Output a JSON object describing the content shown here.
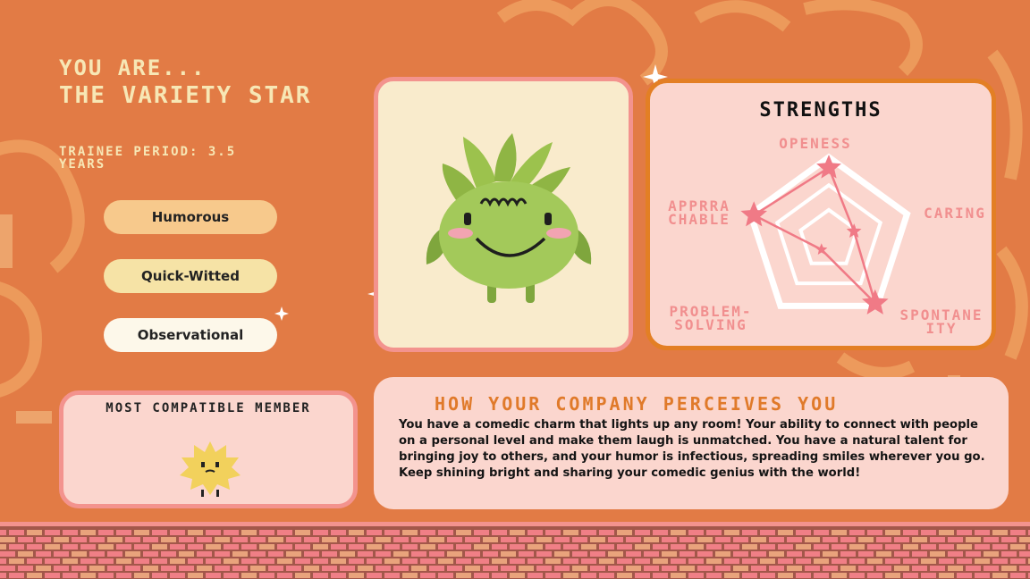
{
  "header": {
    "you_are": "YOU ARE...",
    "result_title": "THE VARIETY STAR",
    "trainee_period": "TRAINEE PERIOD: 3.5 YEARS"
  },
  "traits": [
    "Humorous",
    "Quick-Witted",
    "Observational"
  ],
  "strengths": {
    "title": "STRENGTHS",
    "axes": [
      "OPENESS",
      "CARING",
      "APPRRA CHABLE",
      "PROBLEM- SOLVING",
      "SPONTANE ITY"
    ]
  },
  "chart_data": {
    "type": "radar",
    "title": "STRENGTHS",
    "axes": [
      "OPENESS",
      "CARING",
      "SPONTANE ITY",
      "PROBLEM- SOLVING",
      "APPRRA CHABLE"
    ],
    "values": [
      0.85,
      0.2,
      0.95,
      0.0,
      0.95
    ],
    "range": [
      0,
      1
    ]
  },
  "compatible": {
    "title": "MOST COMPATIBLE MEMBER"
  },
  "perception": {
    "title": "HOW YOUR COMPANY PERCEIVES YOU",
    "text": "You have a comedic charm that lights up any room! Your ability to connect with people on a personal level and make them laugh is unmatched. You have a natural talent for bringing joy to others, and your humor is infectious, spreading smiles wherever you go. Keep shining bright and sharing your comedic genius with the world!"
  },
  "colors": {
    "background": "#e27b45",
    "cream": "#f7e7b5",
    "pink_card": "#fbd6ce",
    "accent_pink": "#f18f8f",
    "accent_orange": "#e07a2a"
  }
}
